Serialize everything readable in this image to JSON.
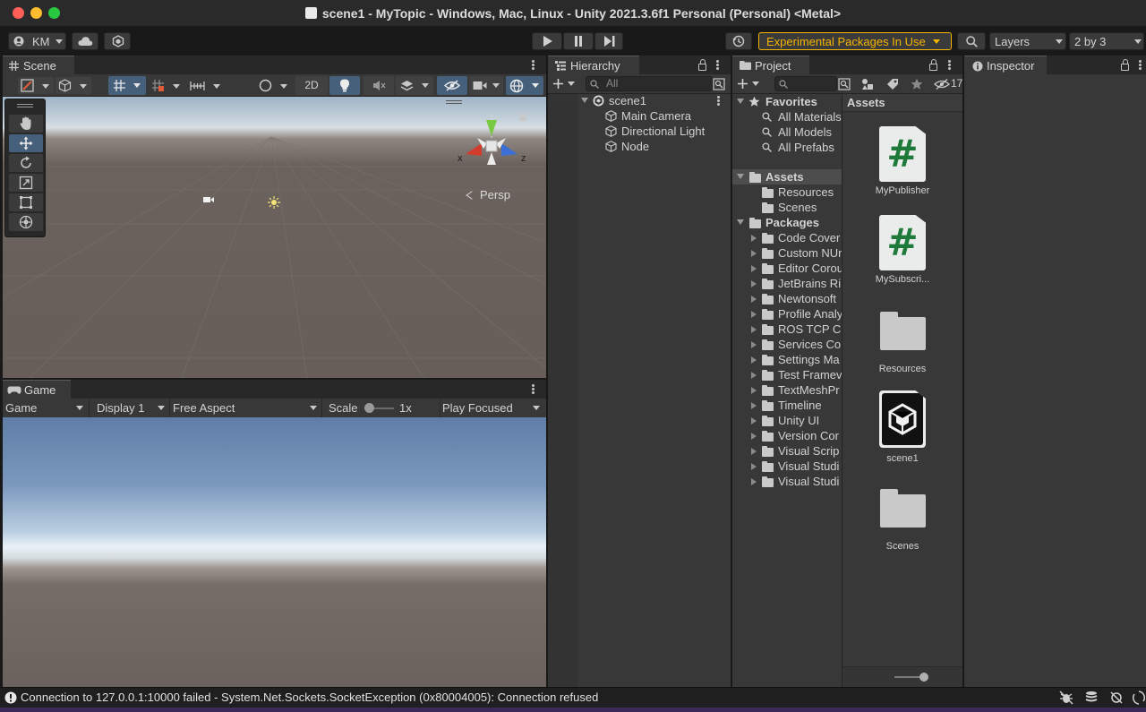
{
  "window": {
    "title": "scene1 - MyTopic - Windows, Mac, Linux - Unity 2021.3.6f1 Personal (Personal) <Metal>"
  },
  "toolbar": {
    "account_label": "KM",
    "experimental_label": "Experimental Packages In Use",
    "layers_label": "Layers",
    "layout_label": "2 by 3",
    "accent": "#f4b400"
  },
  "scene": {
    "tab_label": "Scene",
    "toggle_2d": "2D",
    "persp_label": "Persp",
    "gizmo_x": "x",
    "gizmo_z": "z"
  },
  "game": {
    "tab_label": "Game",
    "mode": "Game",
    "display": "Display 1",
    "aspect": "Free Aspect",
    "scale_label": "Scale",
    "scale_value": "1x",
    "play_mode": "Play Focused"
  },
  "hierarchy": {
    "tab_label": "Hierarchy",
    "search_placeholder": "All",
    "scene_name": "scene1",
    "objects": [
      "Main Camera",
      "Directional Light",
      "Node"
    ]
  },
  "project": {
    "tab_label": "Project",
    "hidden_count": "17",
    "favorites_label": "Favorites",
    "favorites": [
      "All Materials",
      "All Models",
      "All Prefabs"
    ],
    "assets_label": "Assets",
    "asset_folders": [
      "Resources",
      "Scenes"
    ],
    "packages_label": "Packages",
    "packages": [
      "Code Cover",
      "Custom NUr",
      "Editor Corou",
      "JetBrains Ri",
      "Newtonsoft",
      "Profile Analy",
      "ROS TCP Co",
      "Services Co",
      "Settings Ma",
      "Test Framev",
      "TextMeshPr",
      "Timeline",
      "Unity UI",
      "Version Cor",
      "Visual Scrip",
      "Visual Studi",
      "Visual Studi"
    ],
    "grid_header": "Assets",
    "grid_items": [
      {
        "name": "MyPublisher",
        "kind": "script-icon"
      },
      {
        "name": "MySubscri...",
        "kind": "script-icon"
      },
      {
        "name": "Resources",
        "kind": "folder-icon"
      },
      {
        "name": "scene1",
        "kind": "unity-scene-icon"
      },
      {
        "name": "Scenes",
        "kind": "folder-icon"
      }
    ]
  },
  "inspector": {
    "tab_label": "Inspector"
  },
  "status": {
    "message": "Connection to 127.0.0.1:10000 failed - System.Net.Sockets.SocketException (0x80004005): Connection refused"
  }
}
